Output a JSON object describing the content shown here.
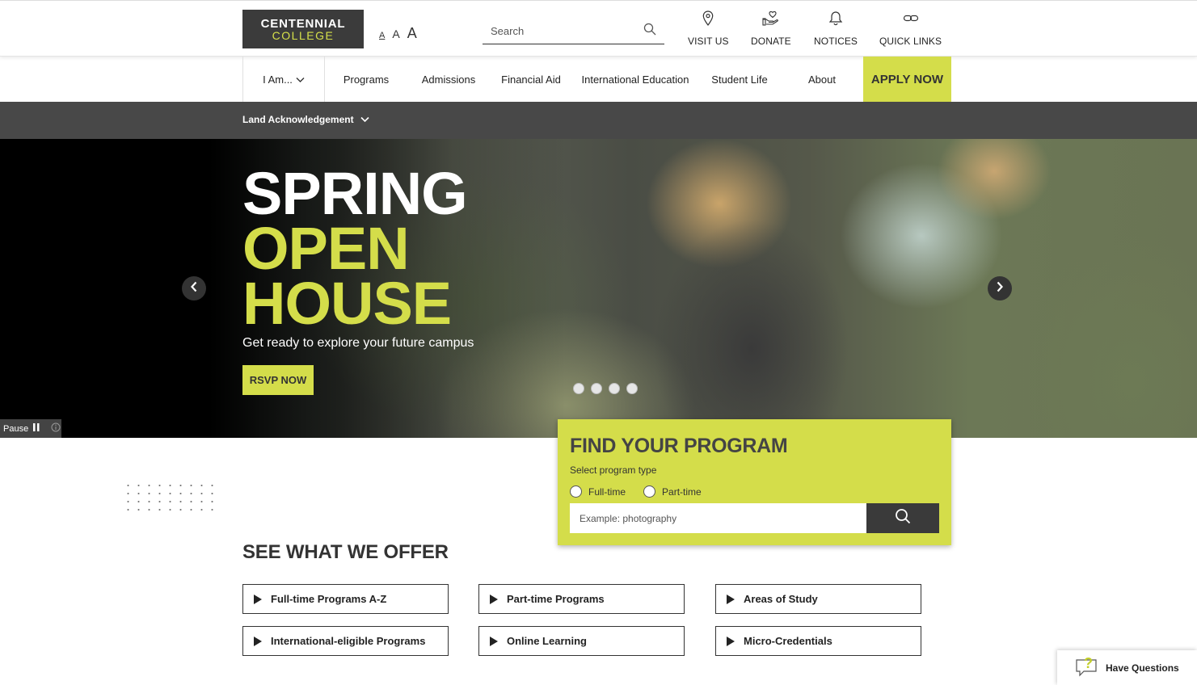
{
  "header": {
    "logo": {
      "line1": "CENTENNIAL",
      "line2": "COLLEGE"
    },
    "font_size_controls": [
      "A",
      "A",
      "A"
    ],
    "search": {
      "placeholder": "Search"
    },
    "utility_links": [
      {
        "label": "VISIT US",
        "icon": "map-pin-icon"
      },
      {
        "label": "DONATE",
        "icon": "donate-hand-heart-icon"
      },
      {
        "label": "NOTICES",
        "icon": "bell-icon"
      },
      {
        "label": "QUICK LINKS",
        "icon": "link-icon"
      }
    ]
  },
  "nav": {
    "iam_label": "I Am...",
    "items": [
      "Programs",
      "Admissions",
      "Financial Aid",
      "International Education",
      "Student Life",
      "About"
    ],
    "apply_label": "APPLY NOW"
  },
  "land_ack": {
    "label": "Land Acknowledgement"
  },
  "hero": {
    "title_line1": "SPRING",
    "title_line2": "OPEN",
    "title_line3": "HOUSE",
    "subtitle": "Get ready to explore your future campus",
    "cta_label": "RSVP NOW",
    "slide_count": 4,
    "pause_label": "Pause"
  },
  "find_program": {
    "title": "FIND YOUR PROGRAM",
    "type_label": "Select program type",
    "options": [
      "Full-time",
      "Part-time"
    ],
    "input_placeholder": "Example: photography"
  },
  "offers": {
    "title": "SEE WHAT WE OFFER",
    "items": [
      "Full-time Programs A-Z",
      "Part-time Programs",
      "Areas of Study",
      "International-eligible Programs",
      "Online Learning",
      "Micro-Credentials"
    ]
  },
  "chat": {
    "label": "Have Questions"
  },
  "colors": {
    "accent": "#d4dd4a",
    "dark": "#3b3b3b",
    "bar": "#484848"
  }
}
